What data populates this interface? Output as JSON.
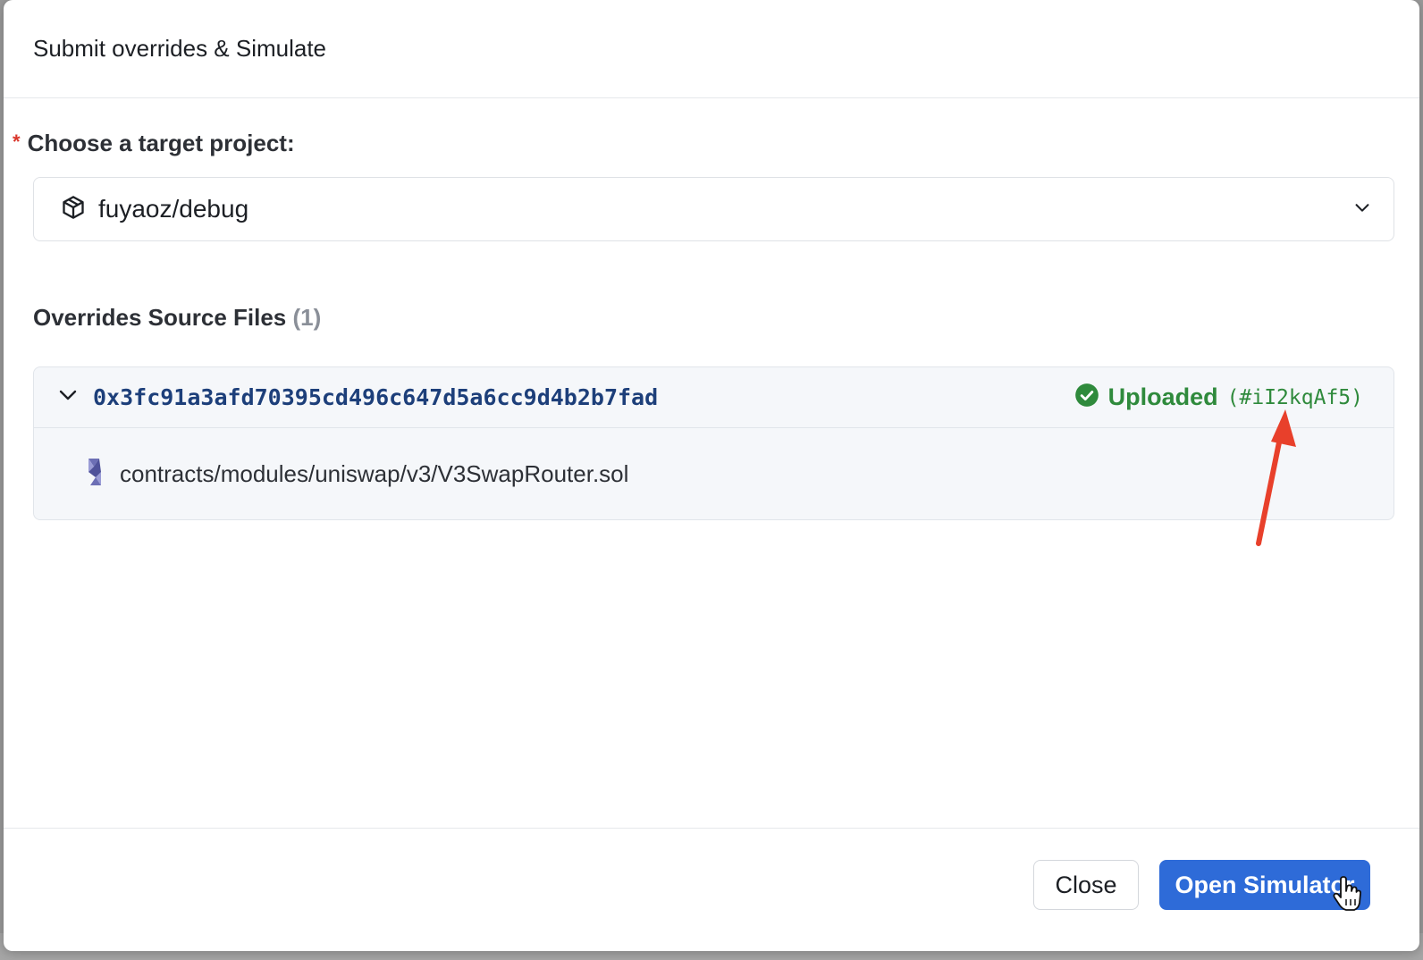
{
  "dialog": {
    "title": "Submit overrides & Simulate"
  },
  "target_project": {
    "label": "Choose a target project:",
    "required_marker": "*",
    "selected_value": "fuyaoz/debug",
    "icon": "package-icon"
  },
  "overrides": {
    "title": "Overrides Source Files",
    "count": "(1)",
    "files": [
      {
        "address": "0x3fc91a3afd70395cd496c647d5a6cc9d4b2b7fad",
        "status": "Uploaded",
        "status_hash": "(#iI2kqAf5)",
        "path": "contracts/modules/uniswap/v3/V3SwapRouter.sol"
      }
    ]
  },
  "footer": {
    "close_label": "Close",
    "primary_label": "Open Simulator"
  },
  "colors": {
    "primary": "#2e6bd8",
    "success": "#2f8a3c",
    "address": "#1d3f7a",
    "annotation_arrow": "#e8402b"
  }
}
